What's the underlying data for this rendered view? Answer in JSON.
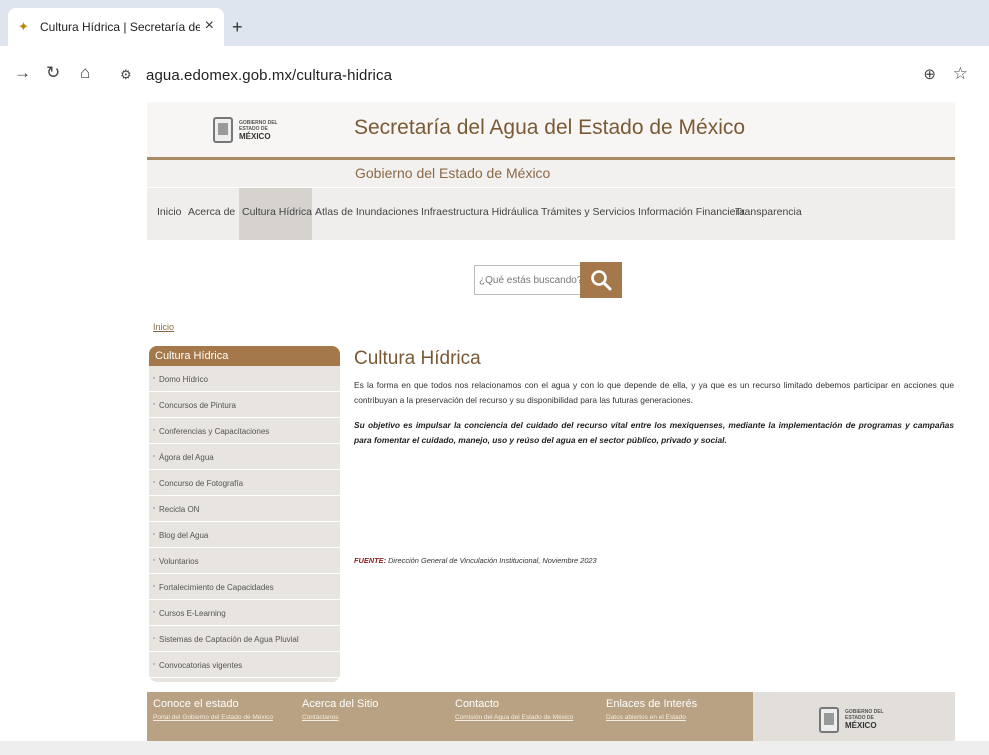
{
  "browser": {
    "tab_title": "Cultura Hídrica | Secretaría del A",
    "new_tab": "+",
    "close": "×",
    "url": "agua.edomex.gob.mx/cultura-hidrica"
  },
  "site": {
    "logo_lines": [
      "GOBIERNO DEL",
      "ESTADO DE",
      "MÉXICO"
    ],
    "title": "Secretaría del Agua del Estado de México",
    "subtitle": "Gobierno del Estado de México",
    "accent": "#a4784a"
  },
  "nav": {
    "items": [
      "Inicio",
      "Acerca de",
      "Cultura Hídrica",
      "Atlas de Inundaciones",
      "Infraestructura Hidráulica",
      "Trámites y Servicios",
      "Información Financiera",
      "Transparencia"
    ],
    "active": "Cultura Hídrica"
  },
  "search": {
    "placeholder": "¿Qué estás buscando?"
  },
  "breadcrumb": "Inicio",
  "sidebar": {
    "header": "Cultura Hídrica",
    "items": [
      "Domo Hídrico",
      "Concursos de Pintura",
      "Conferencias y Capacitaciones",
      "Ágora del Agua",
      "Concurso de Fotografía",
      "Recicla ON",
      "Blog del Agua",
      "Voluntarios",
      "Fortalecimiento de Capacidades",
      "Cursos E-Learning",
      "Sistemas de Captación de Agua Pluvial",
      "Convocatorias vigentes"
    ]
  },
  "main": {
    "heading": "Cultura Hídrica",
    "paragraph1": "Es la forma en que todos nos relacionamos con el agua y con lo que depende de ella, y ya que es un recurso limitado debemos participar en acciones que contribuyan a la preservación del recurso y su disponibilidad para las futuras generaciones.",
    "paragraph2": "Su objetivo es impulsar la conciencia del cuidado del recurso vital entre los mexiquenses, mediante la implementación de programas y campañas para fomentar el cuidado, manejo, uso y reúso del agua en el sector público, privado y social.",
    "source_label": "FUENTE:",
    "source_text": "Dirección General de Vinculación Institucional, Noviembre 2023"
  },
  "footer": {
    "columns": [
      {
        "heading": "Conoce el estado",
        "links": [
          "Portal del Gobierno del Estado de México"
        ]
      },
      {
        "heading": "Acerca del Sitio",
        "links": [
          "Contáctanos"
        ]
      },
      {
        "heading": "Contacto",
        "links": [
          "Comisión del Agua del Estado de México"
        ]
      },
      {
        "heading": "Enlaces de Interés",
        "links": [
          "Datos abiertos en el Estado"
        ]
      }
    ]
  }
}
